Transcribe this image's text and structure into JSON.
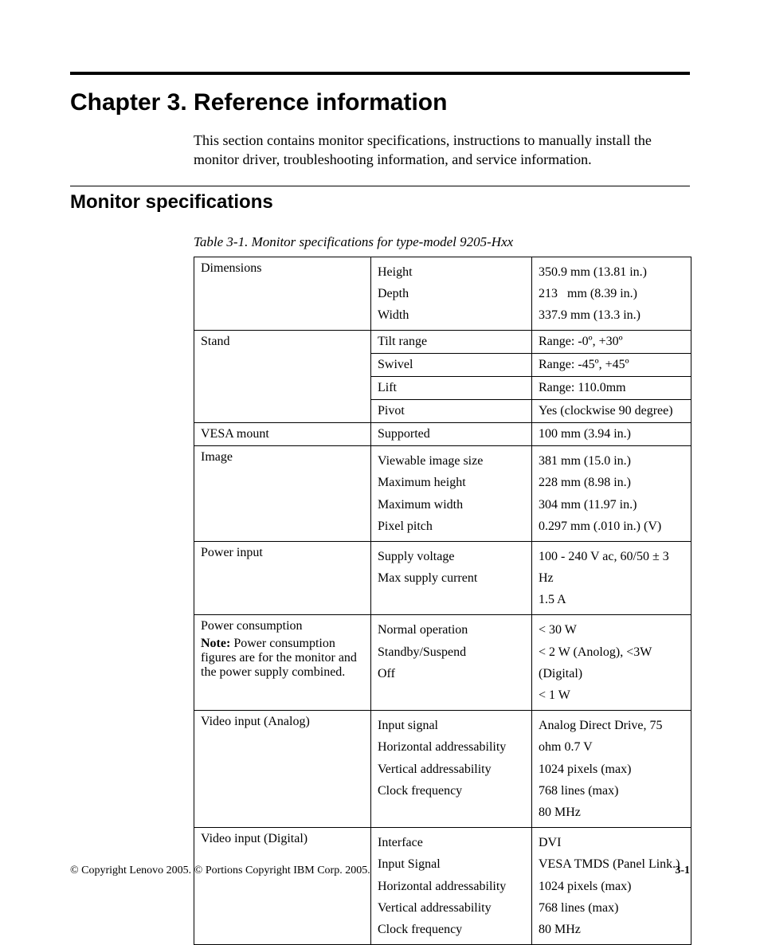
{
  "chapter_title": "Chapter 3. Reference information",
  "intro_text": "This section contains monitor specifications, instructions to manually install the monitor driver, troubleshooting information, and service information.",
  "section_title": "Monitor specifications",
  "table_caption": "Table 3-1. Monitor specifications for type-model 9205-Hxx",
  "rows": {
    "dimensions": {
      "label": "Dimensions",
      "p1": "Height",
      "p2": "Depth",
      "p3": "Width",
      "v1": "350.9 mm (13.81 in.)",
      "v2": "213   mm (8.39 in.)",
      "v3": "337.9 mm (13.3 in.)"
    },
    "stand_tilt": {
      "label": "Stand",
      "prop": "Tilt range",
      "val": "Range: -0º, +30º"
    },
    "stand_swivel": {
      "prop": "Swivel",
      "val": "Range: -45º, +45º"
    },
    "stand_lift": {
      "prop": "Lift",
      "val": "Range: 110.0mm"
    },
    "stand_pivot": {
      "prop": "Pivot",
      "val": "Yes (clockwise 90 degree)"
    },
    "vesa": {
      "label": "VESA mount",
      "prop": "Supported",
      "val": "100 mm (3.94 in.)"
    },
    "image": {
      "label": "Image",
      "p1": "Viewable image size",
      "v1": "381 mm (15.0 in.)",
      "p2": "Maximum height",
      "v2": "228 mm (8.98 in.)",
      "p3": "Maximum width",
      "v3": "304 mm (11.97 in.)",
      "p4": "Pixel pitch",
      "v4": "0.297 mm (.010 in.) (V)"
    },
    "power_input": {
      "label": "Power input",
      "p1": "Supply voltage",
      "v1": "100 - 240 V ac, 60/50 ± 3 Hz",
      "p2": "Max supply current",
      "v2": "1.5 A"
    },
    "power_cons": {
      "label": "Power consumption",
      "note_label": "Note:",
      "note_text": " Power consumption figures are for the monitor and the power supply combined.",
      "p1": "Normal operation",
      "v1": "< 30 W",
      "p2": "Standby/Suspend",
      "v2": "< 2 W (Anolog), <3W (Digital)",
      "p3": "Off",
      "v3": "< 1 W"
    },
    "video_analog": {
      "label": "Video input (Analog)",
      "p1": "Input signal",
      "v1": "Analog Direct Drive, 75 ohm 0.7 V",
      "p2": "Horizontal addressability",
      "v2": "1024 pixels (max)",
      "p3": "Vertical addressability",
      "v3": "768 lines (max)",
      "p4": "Clock frequency",
      "v4": "80 MHz"
    },
    "video_digital": {
      "label": "Video input (Digital)",
      "p1": "Interface",
      "v1": "DVI",
      "p2": "Input Signal",
      "v2": "VESA TMDS (Panel Link.)",
      "p3": "Horizontal addressability",
      "v3": "1024 pixels (max)",
      "p4": "Vertical addressability",
      "v4": "768 lines (max)",
      "p5": "Clock frequency",
      "v5": "80 MHz"
    }
  },
  "footer": {
    "copyright": "© Copyright Lenovo 2005. © Portions Copyright IBM Corp. 2005.",
    "page": "3-1"
  }
}
